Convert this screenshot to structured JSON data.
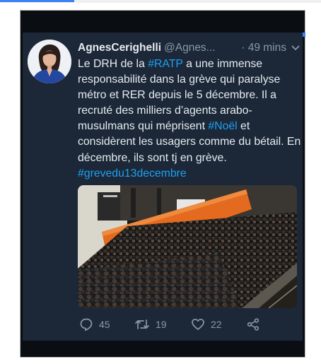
{
  "tweet": {
    "display_name": "AgnesCerighelli",
    "handle": "@Agnes...",
    "time_ago": "· 49 mins",
    "text": {
      "p1": "Le DRH de la ",
      "tag1": "#RATP",
      "p2": " a une immense responsabilité dans la grève qui paralyse métro et RER depuis le 5 décembre. Il a recruté des milliers d’agents arabo-musulmans qui méprisent ",
      "tag2": "#Noël",
      "p3": " et considèrent les usagers comme du bétail. En décembre, ils sont tj en grève. ",
      "tag3": "#grevedu13decembre"
    },
    "replies": "45",
    "retweets": "19",
    "likes": "22"
  },
  "icons": {
    "avatar": "profile-photo",
    "menu": "chevron-down-icon",
    "reply": "reply-icon",
    "retweet": "retweet-icon",
    "like": "heart-icon",
    "share": "share-icon"
  },
  "colors": {
    "background": "#1c2838",
    "text": "#e7ebf0",
    "muted": "#8899a6",
    "hashtag": "#1da1f2"
  }
}
